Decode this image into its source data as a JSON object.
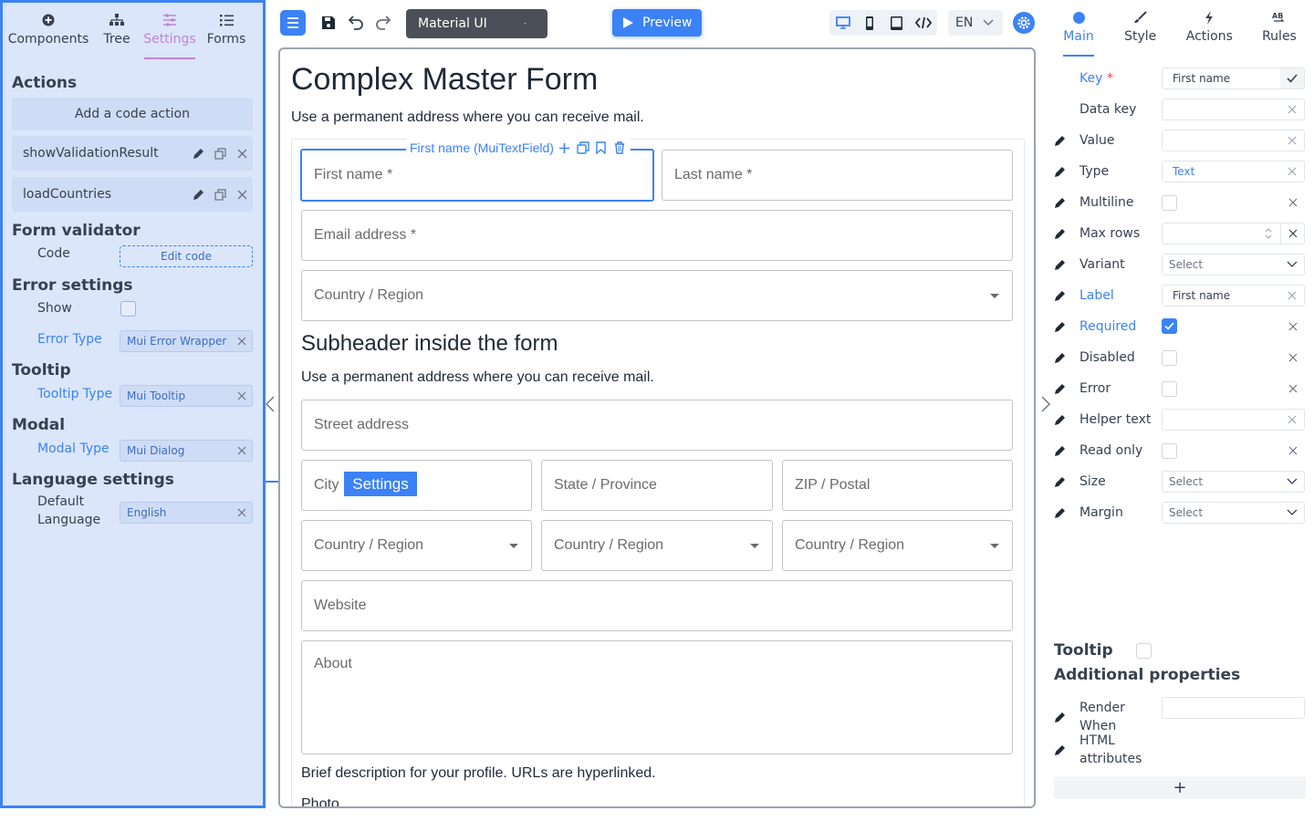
{
  "left_panel": {
    "tabs": [
      {
        "label": "Components",
        "icon": "plus-circle-icon"
      },
      {
        "label": "Tree",
        "icon": "tree-icon"
      },
      {
        "label": "Settings",
        "icon": "sliders-icon",
        "active": true
      },
      {
        "label": "Forms",
        "icon": "list-icon"
      }
    ],
    "actions": {
      "title": "Actions",
      "add_label": "Add a code action",
      "items": [
        {
          "name": "showValidationResult"
        },
        {
          "name": "loadCountries"
        }
      ]
    },
    "form_validator": {
      "title": "Form validator",
      "code_label": "Code",
      "edit_code_label": "Edit code"
    },
    "error_settings": {
      "title": "Error settings",
      "show_label": "Show",
      "error_type_label": "Error Type",
      "error_type_value": "Mui Error Wrapper"
    },
    "tooltip": {
      "title": "Tooltip",
      "type_label": "Tooltip Type",
      "type_value": "Mui Tooltip"
    },
    "modal": {
      "title": "Modal",
      "type_label": "Modal Type",
      "type_value": "Mui Dialog"
    },
    "language": {
      "title": "Language settings",
      "default_label_line1": "Default",
      "default_label_line2": "Language",
      "default_value": "English"
    }
  },
  "toolbar": {
    "library": "Material UI",
    "library_caret": "-",
    "preview_label": "Preview",
    "language": "EN",
    "accent": "#3b82f6"
  },
  "canvas": {
    "title": "Complex Master Form",
    "description": "Use a permanent address where you can receive mail.",
    "selected_component": "First name (MuiTextField)",
    "settings_flag": "Settings",
    "fields": {
      "first_name": "First name *",
      "last_name": "Last name *",
      "email": "Email address *",
      "country_1": "Country / Region",
      "street": "Street address",
      "city": "City",
      "state": "State / Province",
      "zip": "ZIP / Postal",
      "country_2": "Country / Region",
      "country_3": "Country / Region",
      "country_4": "Country / Region",
      "website": "Website",
      "about": "About"
    },
    "subheader": "Subheader inside the form",
    "subheader_desc": "Use a permanent address where you can receive mail.",
    "about_help": "Brief description for your profile. URLs are hyperlinked.",
    "photo_label": "Photo"
  },
  "right_panel": {
    "tabs": [
      {
        "label": "Main",
        "icon": "circle-icon",
        "active": true
      },
      {
        "label": "Style",
        "icon": "brush-icon"
      },
      {
        "label": "Actions",
        "icon": "bolt-icon"
      },
      {
        "label": "Rules",
        "icon": "ab-icon"
      }
    ],
    "props": {
      "key": {
        "label": "Key",
        "value": "First name"
      },
      "data_key": {
        "label": "Data key",
        "value": ""
      },
      "value": {
        "label": "Value",
        "value": ""
      },
      "type": {
        "label": "Type",
        "value": "Text"
      },
      "multiline": {
        "label": "Multiline",
        "checked": false
      },
      "max_rows": {
        "label": "Max rows",
        "value": ""
      },
      "variant": {
        "label": "Variant",
        "value": "Select"
      },
      "label": {
        "label": "Label",
        "value": "First name"
      },
      "required": {
        "label": "Required",
        "checked": true
      },
      "disabled": {
        "label": "Disabled",
        "checked": false
      },
      "error": {
        "label": "Error",
        "checked": false
      },
      "helper_text": {
        "label": "Helper text",
        "value": ""
      },
      "read_only": {
        "label": "Read only",
        "checked": false
      },
      "size": {
        "label": "Size",
        "value": "Select"
      },
      "margin": {
        "label": "Margin",
        "value": "Select"
      }
    },
    "tooltip_label": "Tooltip",
    "additional_title": "Additional properties",
    "render_when_line1": "Render",
    "render_when_line2": "When",
    "html_attr_line1": "HTML",
    "html_attr_line2": "attributes",
    "add_symbol": "+"
  }
}
